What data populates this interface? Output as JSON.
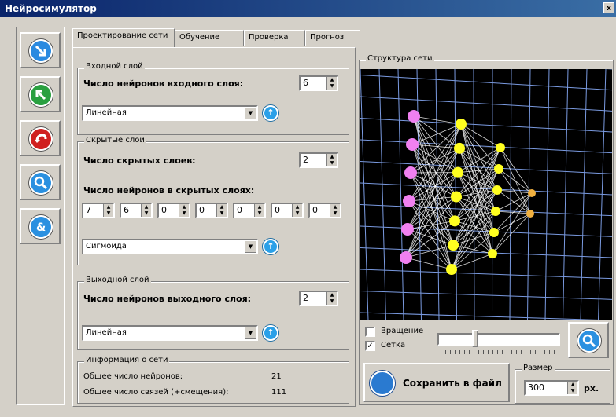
{
  "window": {
    "title": "Нейросимулятор"
  },
  "tabs": [
    {
      "label": "Проектирование сети"
    },
    {
      "label": "Обучение"
    },
    {
      "label": "Проверка"
    },
    {
      "label": "Прогноз"
    }
  ],
  "input_layer": {
    "group_label": "Входной слой",
    "neurons_label": "Число нейронов входного слоя:",
    "neurons_value": "6",
    "activation": "Линейная"
  },
  "hidden_layers": {
    "group_label": "Скрытые слои",
    "count_label": "Число скрытых слоев:",
    "count_value": "2",
    "neurons_label": "Число нейронов в скрытых слоях:",
    "neurons": [
      "7",
      "6",
      "0",
      "0",
      "0",
      "0",
      "0"
    ],
    "activation": "Сигмоида"
  },
  "output_layer": {
    "group_label": "Выходной слой",
    "neurons_label": "Число нейронов выходного слоя:",
    "neurons_value": "2",
    "activation": "Линейная"
  },
  "network_info": {
    "group_label": "Информация о сети",
    "total_neurons_label": "Общее число нейронов:",
    "total_neurons_value": "21",
    "total_links_label": "Общее число связей (+смещения):",
    "total_links_value": "111"
  },
  "structure": {
    "group_label": "Структура сети",
    "rotation_label": "Вращение",
    "rotation_checked": false,
    "grid_label": "Сетка",
    "grid_checked": true,
    "slider_position": 0.3,
    "save_label": "Сохранить в файл",
    "size_group_label": "Размер",
    "size_value": "300",
    "size_unit": "рх."
  },
  "colors": {
    "input_neuron": "#f080f0",
    "hidden1_neuron": "#ffff20",
    "hidden2_neuron": "#ffff20",
    "output_neuron": "#f0b040",
    "grid_line": "#7a9ae0"
  },
  "toolbar_icons": [
    "arrow-down-icon",
    "arrow-up-icon",
    "undo-icon",
    "zoom-icon",
    "link-icon"
  ]
}
